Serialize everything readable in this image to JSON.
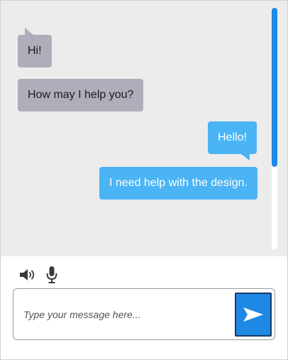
{
  "messages": [
    {
      "text": "Hi!",
      "direction": "incoming"
    },
    {
      "text": "How may I help you?",
      "direction": "incoming"
    },
    {
      "text": "Hello!",
      "direction": "outgoing"
    },
    {
      "text": "I need help with the design.",
      "direction": "outgoing"
    }
  ],
  "composer": {
    "placeholder": "Type your message here...",
    "value": ""
  },
  "toolbar": {
    "icons": [
      "speaker-icon",
      "microphone-icon"
    ]
  },
  "send_button": {
    "icon": "send-arrow-icon"
  },
  "scrollbar": {
    "thumb_fraction": 0.66,
    "position_fraction": 0
  },
  "colors": {
    "incoming_bubble": "#aeaebb",
    "outgoing_bubble": "#4ab4f5",
    "accent": "#1e88e5",
    "chat_background": "#ececec"
  }
}
